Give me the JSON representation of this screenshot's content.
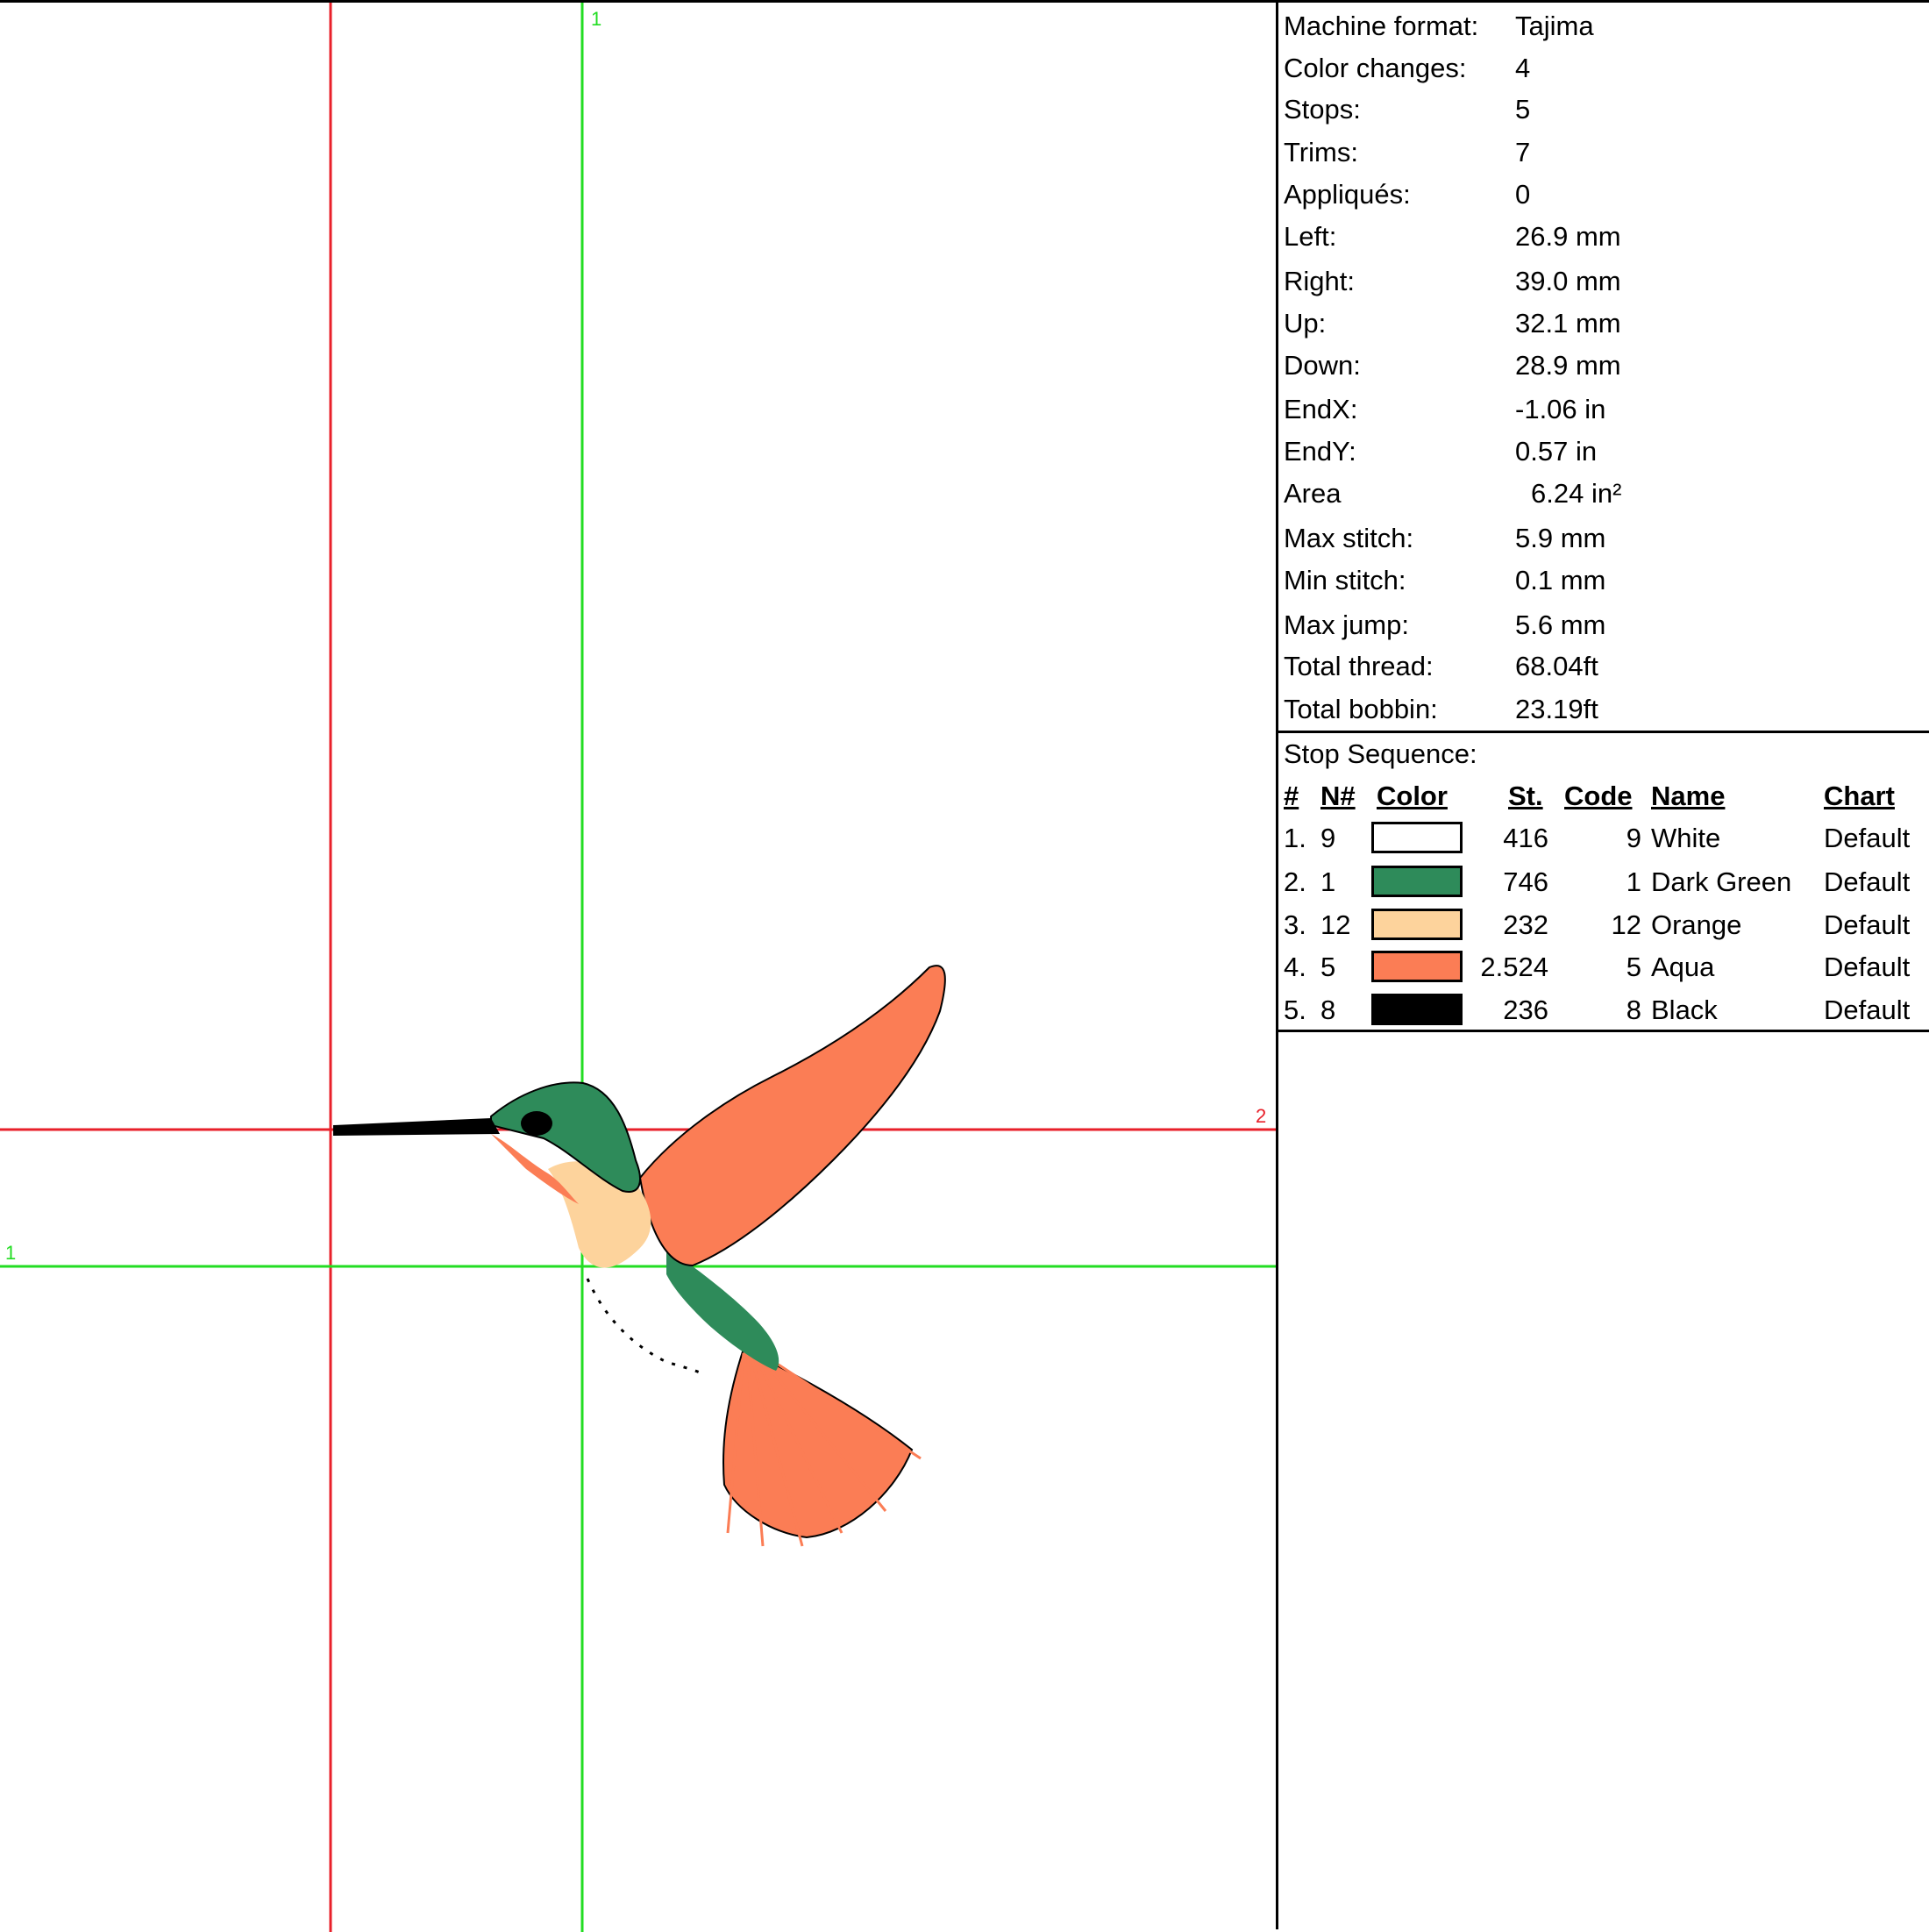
{
  "colors": {
    "red_axis": "#e8202a",
    "green_axis": "#22dd22",
    "dark_green": "#2e8b5a",
    "orange_light": "#fdd39c",
    "aqua_salmon": "#fb7d55",
    "black": "#000000",
    "white": "#ffffff"
  },
  "canvas": {
    "axis_labels": {
      "top_green": "1",
      "left_green": "1",
      "right_red": "2"
    }
  },
  "stats": [
    {
      "label": "Machine format:",
      "value": "Tajima"
    },
    {
      "label": "Color changes:",
      "value": "4"
    },
    {
      "label": "Stops:",
      "value": "5"
    },
    {
      "label": "Trims:",
      "value": "7"
    },
    {
      "label": "Appliqués:",
      "value": "0"
    },
    {
      "label": "Left:",
      "value": "26.9 mm"
    },
    {
      "label": "Right:",
      "value": "39.0 mm"
    },
    {
      "label": "Up:",
      "value": "32.1 mm"
    },
    {
      "label": "Down:",
      "value": "28.9 mm"
    },
    {
      "label": "EndX:",
      "value": "-1.06 in"
    },
    {
      "label": "EndY:",
      "value": "0.57 in"
    },
    {
      "label": "Area",
      "value": "6.24 in²"
    },
    {
      "label": "Max stitch:",
      "value": "5.9 mm"
    },
    {
      "label": "Min stitch:",
      "value": "0.1 mm"
    },
    {
      "label": "Max jump:",
      "value": "5.6 mm"
    },
    {
      "label": "Total thread:",
      "value": "68.04ft"
    },
    {
      "label": "Total bobbin:",
      "value": "23.19ft"
    }
  ],
  "stop_sequence": {
    "title": "Stop Sequence:",
    "headers": {
      "num": "#",
      "n": "N#",
      "color": "Color",
      "st": "St.",
      "code": "Code",
      "name": "Name",
      "chart": "Chart"
    },
    "rows": [
      {
        "num": "1.",
        "n": "9",
        "swatch": "#ffffff",
        "st": "416",
        "code": "9",
        "name": "White",
        "chart": "Default"
      },
      {
        "num": "2.",
        "n": "1",
        "swatch": "#2e8b5a",
        "st": "746",
        "code": "1",
        "name": "Dark Green",
        "chart": "Default"
      },
      {
        "num": "3.",
        "n": "12",
        "swatch": "#fdd39c",
        "st": "232",
        "code": "12",
        "name": "Orange",
        "chart": "Default"
      },
      {
        "num": "4.",
        "n": "5",
        "swatch": "#fb7d55",
        "st": "2.524",
        "code": "5",
        "name": "Aqua",
        "chart": "Default"
      },
      {
        "num": "5.",
        "n": "8",
        "swatch": "#000000",
        "st": "236",
        "code": "8",
        "name": "Black",
        "chart": "Default"
      }
    ]
  }
}
